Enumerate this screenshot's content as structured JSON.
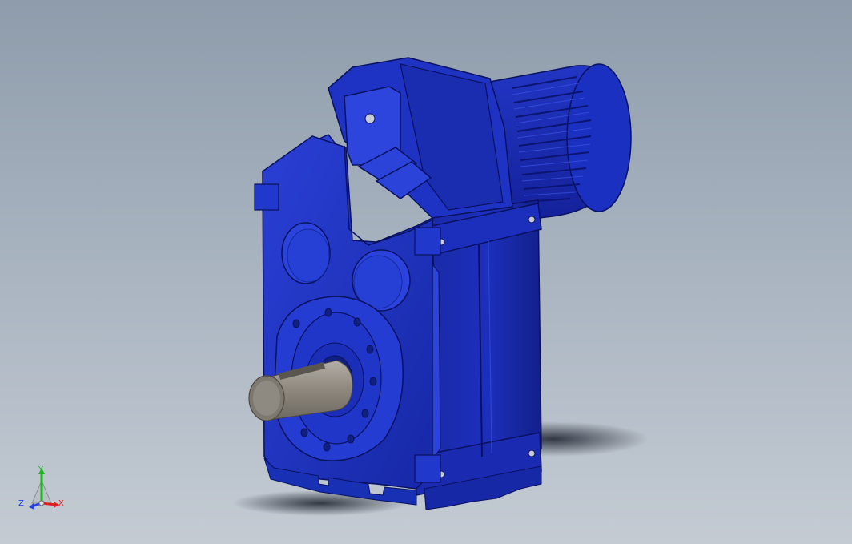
{
  "viewport": {
    "background_top": "#8e9cab",
    "background_bottom": "#c4cbd3"
  },
  "model": {
    "body_color": "#1b2fb4",
    "body_dark": "#0f1a72",
    "shaft_color": "#8f8a82"
  },
  "triad": {
    "x_label": "X",
    "y_label": "Y",
    "z_label": "Z",
    "x_color": "#e02020",
    "y_color": "#1fb51f",
    "z_color": "#2040e0"
  }
}
